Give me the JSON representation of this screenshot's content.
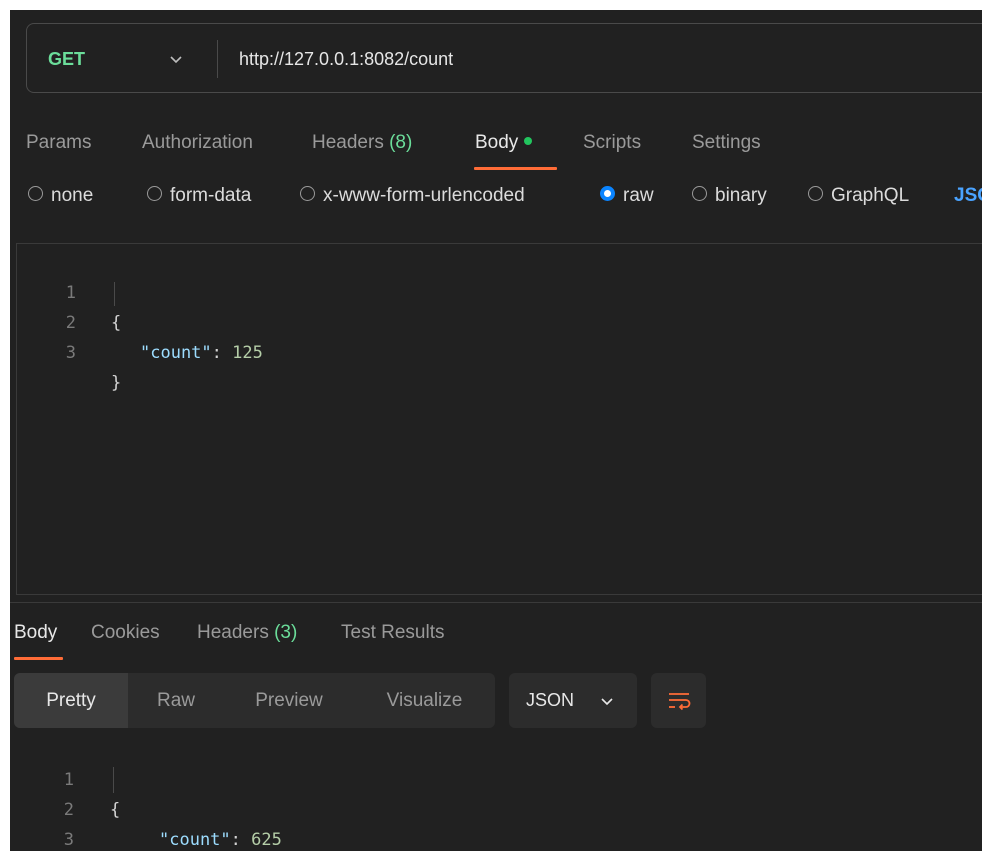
{
  "request": {
    "method": "GET",
    "url": "http://127.0.0.1:8082/count"
  },
  "request_tabs": {
    "params": "Params",
    "authorization": "Authorization",
    "headers_label": "Headers",
    "headers_count": "(8)",
    "body": "Body",
    "scripts": "Scripts",
    "settings": "Settings"
  },
  "body_types": {
    "none": "none",
    "form_data": "form-data",
    "urlencoded": "x-www-form-urlencoded",
    "raw": "raw",
    "binary": "binary",
    "graphql": "GraphQL",
    "json_partial": "JSO",
    "selected": "raw"
  },
  "request_body": {
    "line_numbers": [
      "1",
      "2",
      "3"
    ],
    "open_brace": "{",
    "key": "\"count\"",
    "colon": ": ",
    "value": "125",
    "close_brace": "}"
  },
  "response_tabs": {
    "body": "Body",
    "cookies": "Cookies",
    "headers_label": "Headers",
    "headers_count": "(3)",
    "test_results": "Test Results"
  },
  "response_view": {
    "pretty": "Pretty",
    "raw": "Raw",
    "preview": "Preview",
    "visualize": "Visualize",
    "format": "JSON"
  },
  "response_body": {
    "line_numbers": [
      "1",
      "2",
      "3"
    ],
    "open_brace": "{",
    "key": "\"count\"",
    "colon": ": ",
    "value": "625",
    "close_brace": "}"
  },
  "colors": {
    "method": "#6bdd9a",
    "accent": "#ff6c37",
    "active_dot": "#22c55e",
    "radio_checked": "#0a84ff",
    "link": "#4aa3ff"
  },
  "icons": {
    "method_dropdown": "chevron-down-icon",
    "format_dropdown": "chevron-down-icon",
    "wrap": "wrap-lines-icon"
  }
}
